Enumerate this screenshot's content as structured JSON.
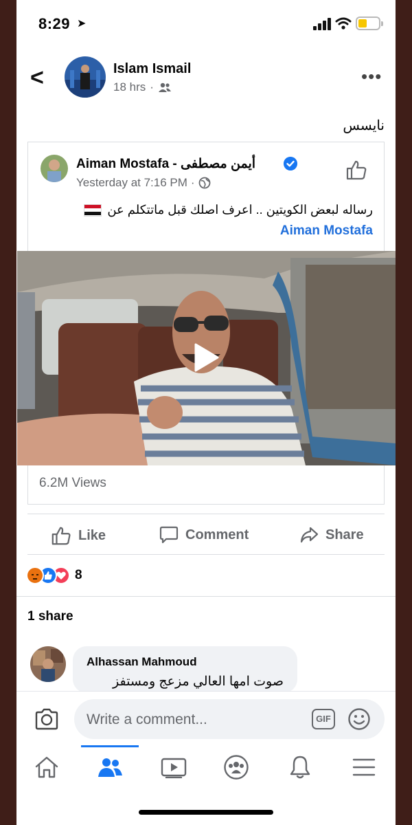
{
  "status_bar": {
    "time": "8:29"
  },
  "post": {
    "author": "Islam Ismail",
    "time": "18 hrs",
    "text": "نايسس",
    "shared": {
      "author": "Aiman Mostafa - أيمن مصطفى",
      "time": "Yesterday at 7:16 PM",
      "text": "رساله لبعض الكويتين .. اعرف اصلك قبل ماتتكلم عن",
      "link_text": "Aiman Mostafa",
      "views": "6.2M Views"
    }
  },
  "actions": {
    "like": "Like",
    "comment": "Comment",
    "share": "Share"
  },
  "reactions": {
    "count": "8",
    "types": [
      "angry-icon",
      "like-icon",
      "love-icon"
    ]
  },
  "shares": "1 share",
  "comment": {
    "author": "Alhassan Mahmoud",
    "text": "صوت امها العالي مزعج ومستفز"
  },
  "composer": {
    "placeholder": "Write a comment...",
    "gif": "GIF"
  },
  "tabs": [
    "home-icon",
    "groups-icon",
    "watch-icon",
    "community-icon",
    "notifications-icon",
    "menu-icon"
  ],
  "colors": {
    "accent": "#1877f2",
    "link": "#216fdb",
    "secondary_text": "#65676b"
  }
}
